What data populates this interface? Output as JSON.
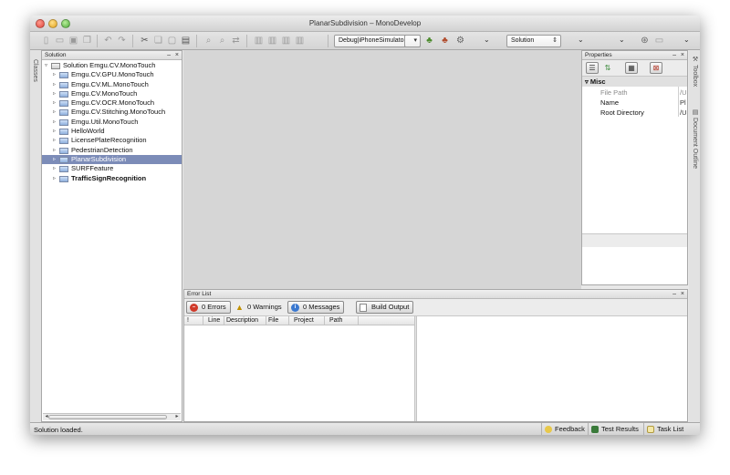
{
  "window": {
    "title": "PlanarSubdivision – MonoDevelop"
  },
  "toolbar": {
    "config_combo": "Debug|iPhoneSimulator",
    "solution_combo": "Solution"
  },
  "left_strip": {
    "label": "Classes"
  },
  "right_strip": {
    "toolbox_label": "Toolbox",
    "outline_label": "Document Outline"
  },
  "solution_panel": {
    "title": "Solution",
    "items": [
      {
        "label": "Solution Emgu.CV.MonoTouch",
        "level": 0,
        "bold": false,
        "selected": false
      },
      {
        "label": "Emgu.CV.GPU.MonoTouch",
        "level": 1,
        "bold": false,
        "selected": false
      },
      {
        "label": "Emgu.CV.ML.MonoTouch",
        "level": 1,
        "bold": false,
        "selected": false
      },
      {
        "label": "Emgu.CV.MonoTouch",
        "level": 1,
        "bold": false,
        "selected": false
      },
      {
        "label": "Emgu.CV.OCR.MonoTouch",
        "level": 1,
        "bold": false,
        "selected": false
      },
      {
        "label": "Emgu.CV.Stitching.MonoTouch",
        "level": 1,
        "bold": false,
        "selected": false
      },
      {
        "label": "Emgu.Util.MonoTouch",
        "level": 1,
        "bold": false,
        "selected": false
      },
      {
        "label": "HelloWorld",
        "level": 1,
        "bold": false,
        "selected": false
      },
      {
        "label": "LicensePlateRecognition",
        "level": 1,
        "bold": false,
        "selected": false
      },
      {
        "label": "PedestrianDetection",
        "level": 1,
        "bold": false,
        "selected": false
      },
      {
        "label": "PlanarSubdivision",
        "level": 1,
        "bold": false,
        "selected": true
      },
      {
        "label": "SURFFeature",
        "level": 1,
        "bold": false,
        "selected": false
      },
      {
        "label": "TrafficSignRecognition",
        "level": 1,
        "bold": true,
        "selected": false
      }
    ]
  },
  "properties_panel": {
    "title": "Properties",
    "category": "Misc",
    "rows": [
      {
        "name": "File Path",
        "value": "/U",
        "dim": true
      },
      {
        "name": "Name",
        "value": "Pl",
        "dim": false
      },
      {
        "name": "Root Directory",
        "value": "/U",
        "dim": false
      }
    ]
  },
  "error_panel": {
    "title": "Error List",
    "errors_label": "0 Errors",
    "warnings_label": "0 Warnings",
    "messages_label": "0 Messages",
    "build_output_label": "Build Output",
    "columns": [
      "!",
      "Line",
      "Description",
      "File",
      "Project",
      "Path"
    ]
  },
  "statusbar": {
    "text": "Solution loaded.",
    "feedback": "Feedback",
    "test_results": "Test Results",
    "task_list": "Task List"
  },
  "colors": {
    "selection": "#7c8cb8",
    "error_red": "#d03a2a",
    "message_blue": "#3a78d0"
  }
}
